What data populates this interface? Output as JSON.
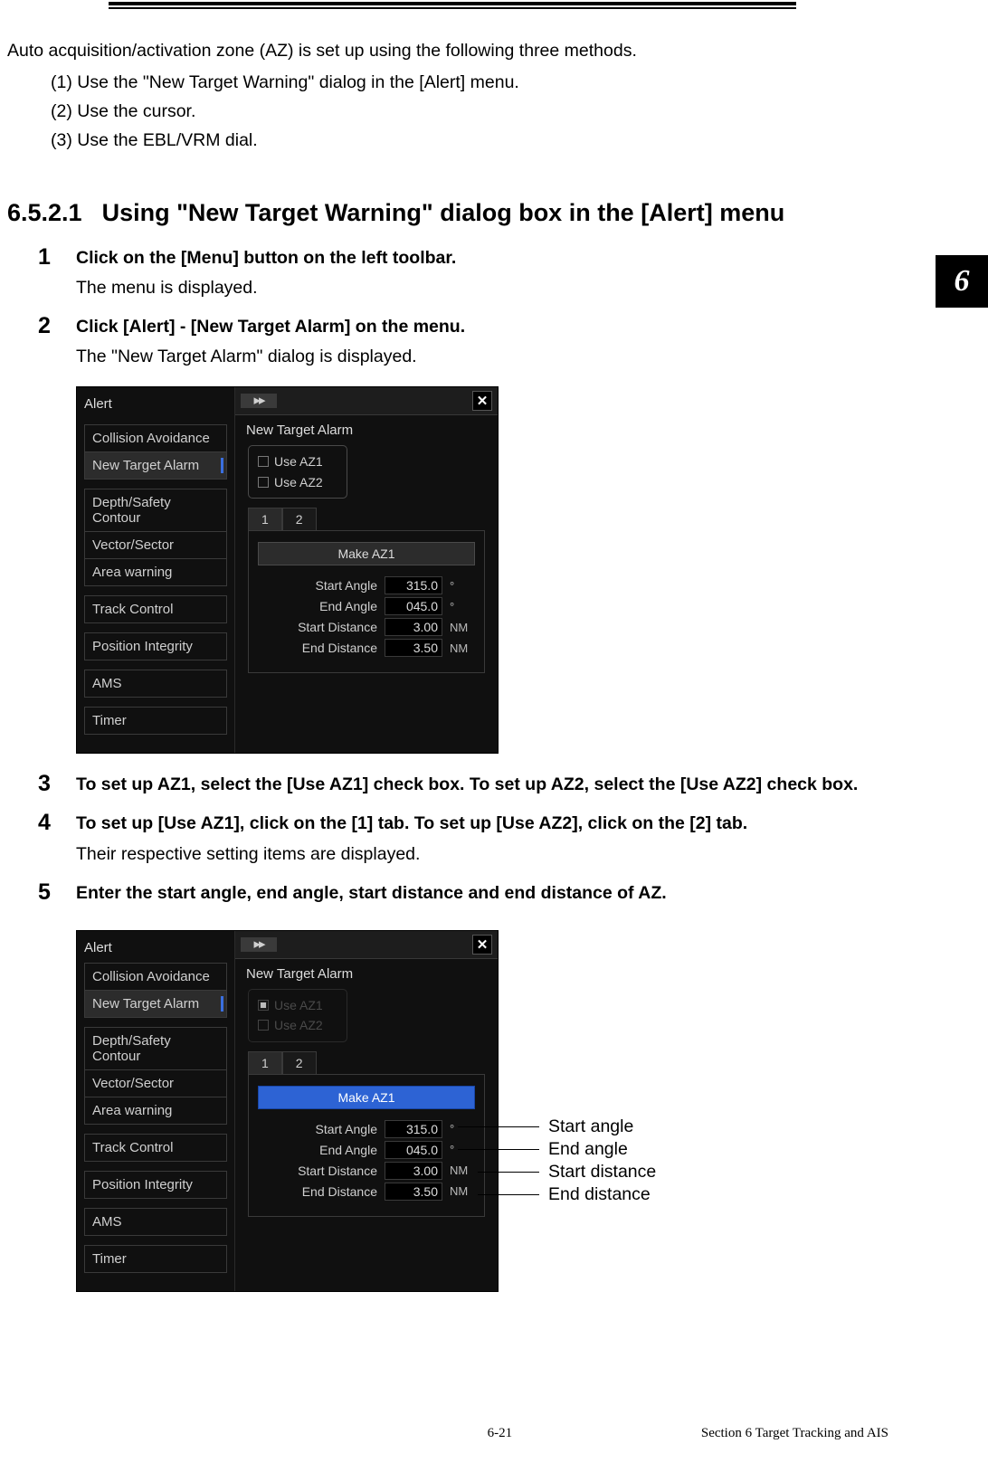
{
  "intro": {
    "line1": "Auto acquisition/activation zone (AZ) is set up using the following three methods.",
    "sub1": "(1) Use the \"New Target Warning\" dialog in the [Alert] menu.",
    "sub2": "(2) Use the cursor.",
    "sub3": "(3) Use the EBL/VRM dial."
  },
  "heading": {
    "num": "6.5.2.1",
    "text": "Using \"New Target Warning\" dialog box in the [Alert] menu"
  },
  "side_tab": "6",
  "steps": {
    "s1_title": "Click on the [Menu] button on the left toolbar.",
    "s1_text": "The menu is displayed.",
    "s2_title": "Click [Alert] - [New Target Alarm] on the menu.",
    "s2_text": "The \"New Target Alarm\" dialog is displayed.",
    "s3_title": "To set up AZ1, select the [Use AZ1] check box. To set up AZ2, select the [Use AZ2] check box.",
    "s4_title": "To set up [Use AZ1], click on the [1] tab. To set up [Use AZ2], click on the [2] tab.",
    "s4_text": "Their respective setting items are displayed.",
    "s5_title": "Enter the start angle, end angle, start distance and end distance of AZ."
  },
  "dialog": {
    "title": "Alert",
    "arrows": "▸▸",
    "close": "✕",
    "subtitle": "New Target Alarm",
    "sidebar_groups": [
      [
        "Collision Avoidance",
        "New Target Alarm"
      ],
      [
        "Depth/Safety Contour",
        "Vector/Sector",
        "Area warning"
      ],
      [
        "Track Control"
      ],
      [
        "Position Integrity"
      ],
      [
        "AMS"
      ],
      [
        "Timer"
      ]
    ],
    "use_az1": "Use AZ1",
    "use_az2": "Use AZ2",
    "tab1": "1",
    "tab2": "2",
    "make_btn": "Make AZ1",
    "fields": {
      "start_angle_label": "Start Angle",
      "start_angle_value": "315.0",
      "angle_unit": "°",
      "end_angle_label": "End Angle",
      "end_angle_value": "045.0",
      "start_distance_label": "Start Distance",
      "start_distance_value": "3.00",
      "dist_unit": "NM",
      "end_distance_label": "End Distance",
      "end_distance_value": "3.50"
    }
  },
  "callouts": {
    "start_angle": "Start angle",
    "end_angle": "End angle",
    "start_distance": "Start distance",
    "end_distance": "End distance"
  },
  "footer": {
    "page": "6-21",
    "section": "Section 6   Target Tracking and AIS"
  }
}
